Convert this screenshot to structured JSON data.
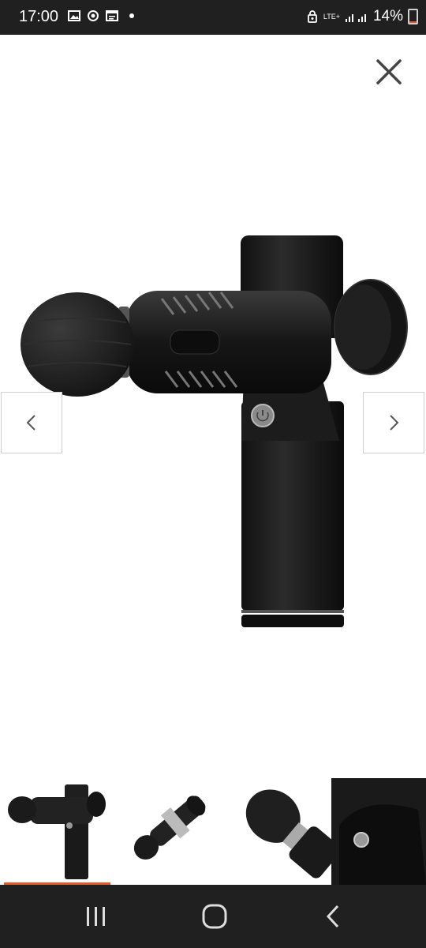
{
  "status_bar": {
    "time": "17:00",
    "icons_left": [
      "gallery-icon",
      "sync-icon",
      "calendar-icon",
      "dot-icon"
    ],
    "network": "LTE+",
    "battery": "14%",
    "battery_level": 0.14,
    "colors": {
      "background": "#202020",
      "battery_low": "#e35b2d"
    }
  },
  "viewer": {
    "close_icon": "close-icon",
    "prev_icon": "chevron-left-icon",
    "next_icon": "chevron-right-icon",
    "image": "massage-gun-product-image"
  },
  "thumbnails": [
    {
      "name": "thumb-side-view",
      "active": true
    },
    {
      "name": "thumb-angled-view",
      "active": false
    },
    {
      "name": "thumb-head-closeup",
      "active": false
    },
    {
      "name": "thumb-button-closeup",
      "active": false
    }
  ],
  "accent_color": "#e35b2d",
  "nav_bar": {
    "buttons": [
      "recent-apps-icon",
      "home-icon",
      "back-icon"
    ]
  }
}
